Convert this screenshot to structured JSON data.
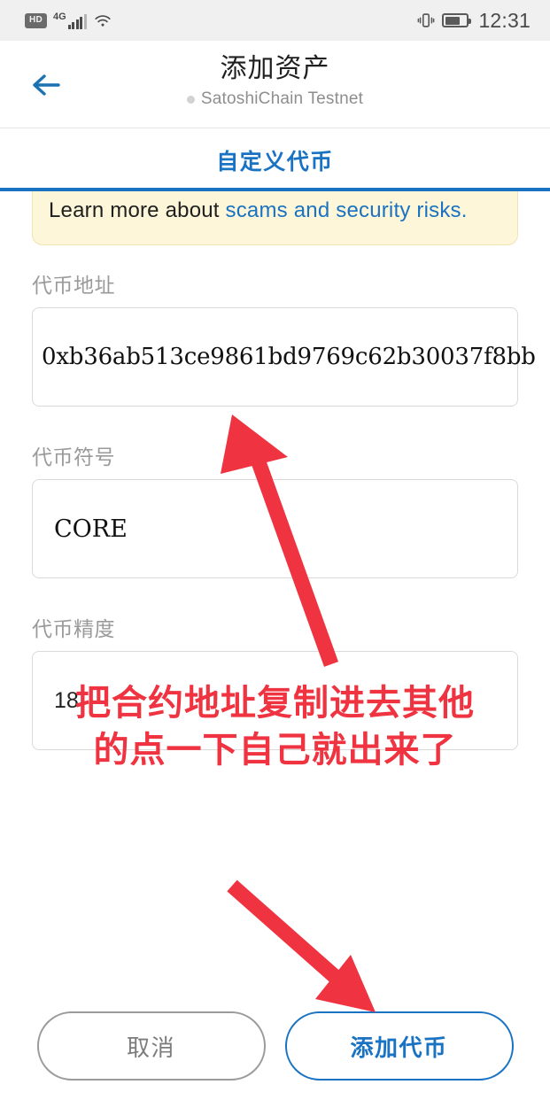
{
  "status_bar": {
    "hd_label": "HD",
    "network_label": "4G",
    "signal_icon": "signal-bars-icon",
    "wifi_icon": "wifi-icon",
    "vibrate_icon": "vibrate-icon",
    "battery_icon": "battery-icon",
    "battery_level_percent": 70,
    "time": "12:31"
  },
  "header": {
    "back_icon": "back-arrow-icon",
    "title": "添加资产",
    "network_dot_icon": "network-status-dot-icon",
    "subtitle": "SatoshiChain Testnet"
  },
  "tabs": {
    "active_label": "自定义代币"
  },
  "warning": {
    "text_prefix": "Learn more about ",
    "link_text": "scams and security risks."
  },
  "form": {
    "address": {
      "label": "代币地址",
      "value": "0xb36ab513ce9861bd9769c62b30037f8bb"
    },
    "symbol": {
      "label": "代币符号",
      "value": "CORE"
    },
    "decimals": {
      "label": "代币精度",
      "value": "18"
    }
  },
  "buttons": {
    "cancel_label": "取消",
    "add_label": "添加代币"
  },
  "annotation": {
    "line1": "把合约地址复制进去其他",
    "line2": "的点一下自己就出来了",
    "arrow_to_address": "red-arrow-up-icon",
    "arrow_to_add_button": "red-arrow-down-icon"
  },
  "colors": {
    "accent_blue": "#1a73c2",
    "annotation_red": "#ef3340",
    "warning_bg": "#fdf6d8",
    "status_bar_bg": "#f0f0f0"
  }
}
